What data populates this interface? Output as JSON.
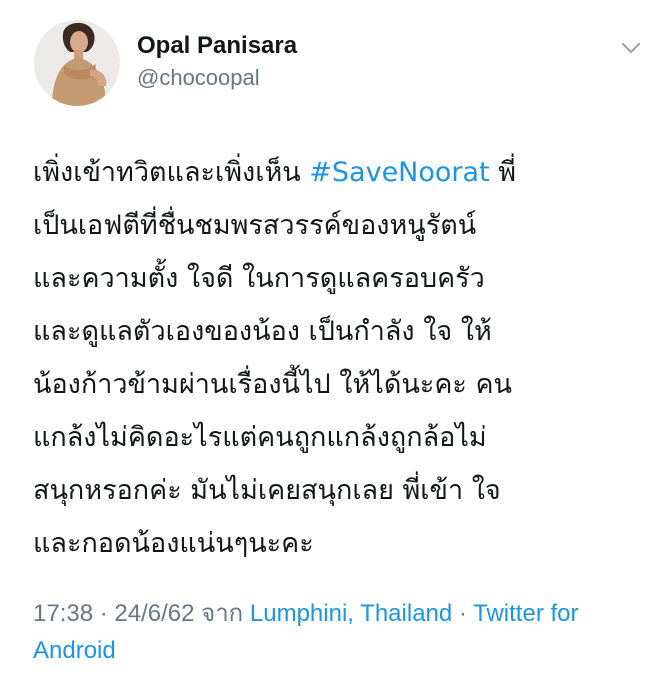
{
  "author": {
    "display_name": "Opal Panisara",
    "handle": "@chocoopal"
  },
  "icons": {
    "avatar": "profile-photo",
    "menu": "chevron-down-icon"
  },
  "tweet": {
    "lines": [
      {
        "before": "เพิ่งเข้าทวิตและเพิ่งเห็น ",
        "hashtag": "#SaveNoorat",
        "after": " พี่"
      },
      {
        "text": "เป็นเอฟตีที่ชื่นชมพรสวรรค์ของหนูรัตน์"
      },
      {
        "text": "และความตั้ง ใจดี ในการดูแลครอบครัว"
      },
      {
        "text": "และดูแลตัวเองของน้อง เป็นกำลัง ใจ ให้"
      },
      {
        "text": "น้องก้าวข้ามผ่านเรื่องนี้ไป ให้ได้นะคะ คน"
      },
      {
        "text": "แกล้งไม่คิดอะไรแต่คนถูกแกล้งถูกล้อไม่"
      },
      {
        "text": "สนุกหรอกค่ะ มันไม่เคยสนุกเลย พี่เข้า ใจ"
      },
      {
        "text": "และกอดน้องแน่นๆนะคะ"
      }
    ]
  },
  "meta": {
    "time_date": "17:38 · 24/6/62 จาก ",
    "location": "Lumphini, Thailand",
    "separator": " · ",
    "source": "Twitter for Android"
  },
  "colors": {
    "link": "#1b95e0",
    "secondary_text": "#657786",
    "primary_text": "#14171a"
  }
}
